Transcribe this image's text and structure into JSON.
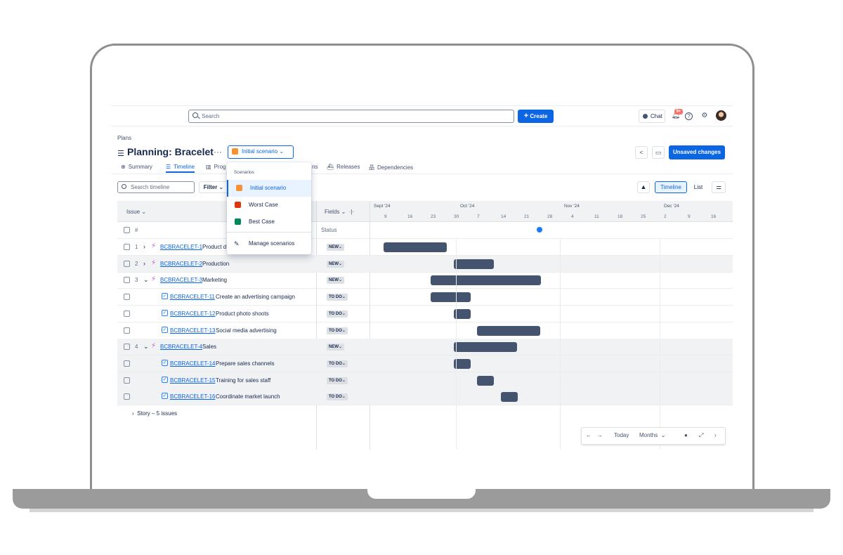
{
  "topnav": {
    "search_placeholder": "Search",
    "create_label": "Create",
    "chat_label": "Chat",
    "notifications_badge": "9+",
    "help_icon": "?",
    "settings_icon": "⚙"
  },
  "header": {
    "breadcrumb": "Plans",
    "title": "Planning: Bracelet",
    "more": "···",
    "scenario_label": "Initial scenario",
    "unsaved_label": "Unsaved changes"
  },
  "tabs": [
    {
      "label": "Summary",
      "icon": "⊕"
    },
    {
      "label": "Timeline",
      "icon": "☰"
    },
    {
      "label": "Prog",
      "icon": "▥"
    },
    {
      "label": "ns",
      "icon": ""
    },
    {
      "label": "Releases",
      "icon": "⛴"
    },
    {
      "label": "Dependencies",
      "icon": "品"
    }
  ],
  "toolbar": {
    "search_placeholder": "Search timeline",
    "filter_label": "Filter",
    "timeline_label": "Timeline",
    "list_label": "List"
  },
  "grid": {
    "issue_header": "Issue",
    "fields_header": "Fields",
    "hash_label": "#",
    "status_header": "Status"
  },
  "timeline": {
    "months": [
      "Sept '24",
      "Oct '24",
      "Nov '24",
      "Dec '24"
    ],
    "days": [
      "9",
      "16",
      "23",
      "30",
      "7",
      "14",
      "21",
      "28",
      "4",
      "11",
      "18",
      "25",
      "2",
      "9",
      "16"
    ]
  },
  "rows": [
    {
      "num": "1",
      "key": "BCBRACELET-1",
      "summary": "Product d",
      "status": "NEW",
      "type": "epic",
      "expanded": false,
      "shaded": false
    },
    {
      "num": "2",
      "key": "BCBRACELET-2",
      "summary": "Production",
      "status": "NEW",
      "type": "epic",
      "expanded": false,
      "shaded": true
    },
    {
      "num": "3",
      "key": "BCBRACELET-3",
      "summary": "Marketing",
      "status": "NEW",
      "type": "epic",
      "expanded": true,
      "shaded": false
    },
    {
      "num": "",
      "key": "BCBRACELET-11",
      "summary": "Create an advertising campaign",
      "status": "TO DO",
      "type": "task",
      "shaded": false
    },
    {
      "num": "",
      "key": "BCBRACELET-12",
      "summary": "Product photo shoots",
      "status": "TO DO",
      "type": "task",
      "shaded": false
    },
    {
      "num": "",
      "key": "BCBRACELET-13",
      "summary": "Social media advertising",
      "status": "TO DO",
      "type": "task",
      "shaded": false
    },
    {
      "num": "4",
      "key": "BCBRACELET-4",
      "summary": "Sales",
      "status": "NEW",
      "type": "epic",
      "expanded": true,
      "shaded": true
    },
    {
      "num": "",
      "key": "BCBRACELET-14",
      "summary": "Prepare sales channels",
      "status": "TO DO",
      "type": "task",
      "shaded": true
    },
    {
      "num": "",
      "key": "BCBRACELET-15",
      "summary": "Training for sales staff",
      "status": "TO DO",
      "type": "task",
      "shaded": true
    },
    {
      "num": "",
      "key": "BCBRACELET-16",
      "summary": "Coordinate market launch",
      "status": "TO DO",
      "type": "task",
      "shaded": true
    }
  ],
  "story_group": "Story – 5 issues",
  "dropdown": {
    "header": "Scenarios",
    "items": [
      {
        "label": "Initial scenario",
        "color": "#f79232",
        "selected": true
      },
      {
        "label": "Worst Case",
        "color": "#de350b",
        "selected": false
      },
      {
        "label": "Best Case",
        "color": "#00875a",
        "selected": false
      }
    ],
    "manage_label": "Manage scenarios"
  },
  "bottom_controls": {
    "today_label": "Today",
    "months_label": "Months"
  }
}
